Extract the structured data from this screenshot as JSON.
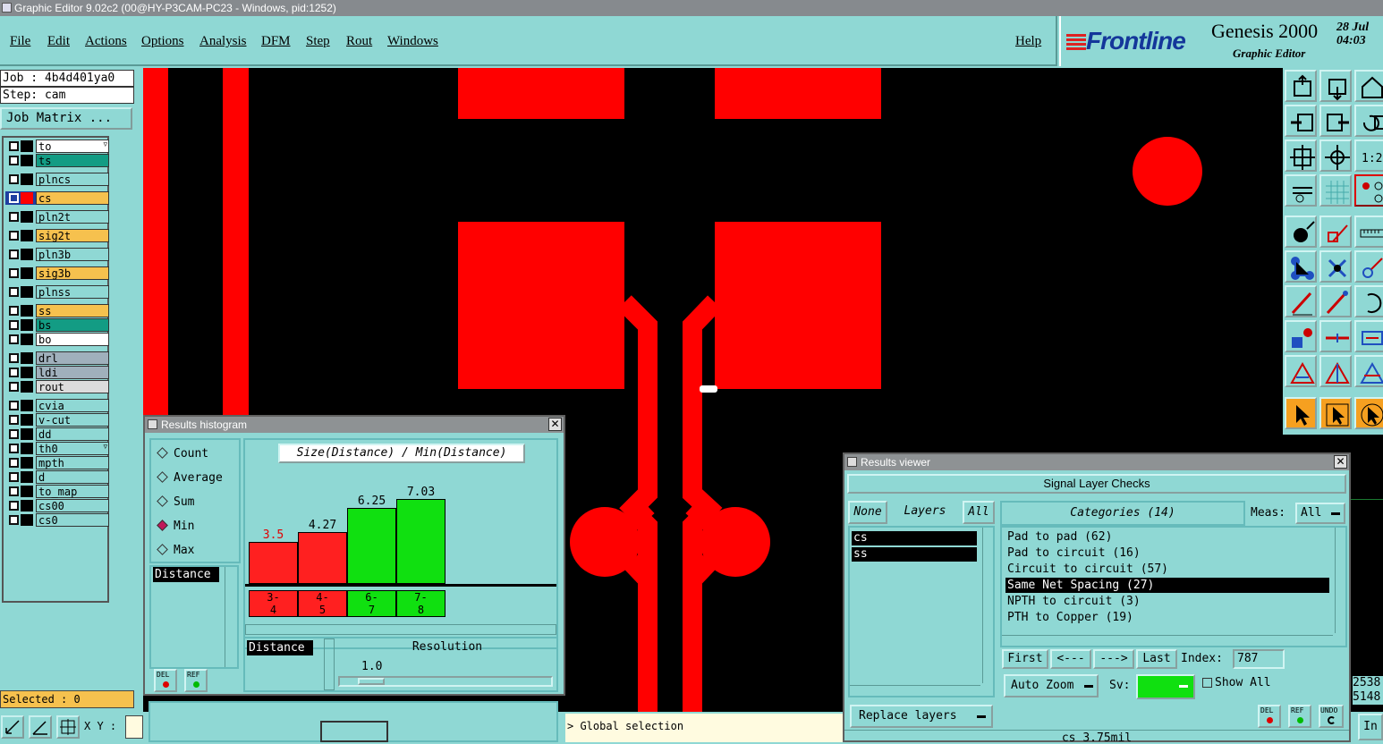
{
  "window": {
    "title": "Graphic Editor 9.02c2 (00@HY-P3CAM-PC23 - Windows, pid:1252)"
  },
  "menu": {
    "file": "File",
    "edit": "Edit",
    "actions": "Actions",
    "options": "Options",
    "analysis": "Analysis",
    "dfm": "DFM",
    "step": "Step",
    "rout": "Rout",
    "windows": "Windows",
    "help": "Help"
  },
  "brand": {
    "logo": "Frontline",
    "product": "Genesis 2000",
    "subtitle": "Graphic Editor",
    "date_line1": "28 Jul",
    "date_line2": "04:03"
  },
  "job": {
    "job": "Job : 4b4d401ya0",
    "step": "Step: cam",
    "matrix_button": "Job Matrix ..."
  },
  "layers": [
    {
      "name": "to",
      "color": "#ffffff",
      "mark": "▿"
    },
    {
      "name": "ts",
      "color": "#139c84"
    },
    {
      "name": "plncs",
      "color": "#8fd8d4"
    },
    {
      "name": "cs",
      "color": "#f6c14e",
      "active": true
    },
    {
      "name": "pln2t",
      "color": "#8fd8d4"
    },
    {
      "name": "sig2t",
      "color": "#f6c14e"
    },
    {
      "name": "pln3b",
      "color": "#8fd8d4"
    },
    {
      "name": "sig3b",
      "color": "#f6c14e"
    },
    {
      "name": "plnss",
      "color": "#8fd8d4"
    },
    {
      "name": "ss",
      "color": "#f6c14e"
    },
    {
      "name": "bs",
      "color": "#139c84"
    },
    {
      "name": "bo",
      "color": "#ffffff"
    },
    {
      "name": "drl",
      "color": "#a0b0bc"
    },
    {
      "name": "ldi",
      "color": "#a0b0bc"
    },
    {
      "name": "rout",
      "color": "#dcdcdc"
    },
    {
      "name": "cvia",
      "color": "#8fd8d4"
    },
    {
      "name": "v-cut",
      "color": "#8fd8d4"
    },
    {
      "name": "dd",
      "color": "#8fd8d4"
    },
    {
      "name": "th0",
      "color": "#8fd8d4",
      "mark": "▿"
    },
    {
      "name": "mpth",
      "color": "#8fd8d4"
    },
    {
      "name": "d",
      "color": "#8fd8d4"
    },
    {
      "name": "to_map",
      "color": "#8fd8d4"
    },
    {
      "name": "cs00",
      "color": "#8fd8d4"
    },
    {
      "name": "cs0",
      "color": "#8fd8d4"
    }
  ],
  "status": {
    "selected": "Selected : 0",
    "xy_label": "X Y :",
    "global_selection": "> Global selection"
  },
  "histogram": {
    "title": "Results histogram",
    "modes": [
      "Count",
      "Average",
      "Sum",
      "Min",
      "Max"
    ],
    "selected_mode": "Min",
    "header": "Size(Distance) / Min(Distance)",
    "list_item": "Distance",
    "bottom_item": "Distance",
    "resolution_label": "Resolution",
    "resolution_value": "1.0",
    "bars": [
      {
        "range": "3-\n4",
        "value": 3.5,
        "label": "3.5",
        "color": "#ff2020"
      },
      {
        "range": "4-\n5",
        "value": 4.27,
        "label": "4.27",
        "color": "#ff2020"
      },
      {
        "range": "6-\n7",
        "value": 6.25,
        "label": "6.25",
        "color": "#10e010"
      },
      {
        "range": "7-\n8",
        "value": 7.03,
        "label": "7.03",
        "color": "#10e010"
      }
    ],
    "del": "DEL",
    "ref": "REF"
  },
  "viewer": {
    "title": "Results viewer",
    "header": "Signal Layer Checks",
    "none": "None",
    "layers_label": "Layers",
    "all": "All",
    "categories_label": "Categories (14)",
    "meas_label": "Meas:",
    "meas_value": "All",
    "layer_items": [
      "cs",
      "ss"
    ],
    "categories": [
      "Pad to pad (62)",
      "Pad to circuit (16)",
      "Circuit to circuit (57)",
      "Same Net Spacing (27)",
      "NPTH to circuit (3)",
      "PTH to Copper (19)"
    ],
    "selected_category": "Same Net Spacing (27)",
    "first": "First",
    "prev": "<---",
    "next": "--->",
    "last": "Last",
    "index_label": "Index:",
    "index_value": "787",
    "auto_zoom": "Auto Zoom",
    "sv_label": "Sv:",
    "show_all": "Show All",
    "replace_layers": "Replace layers",
    "del": "DEL",
    "ref": "REF",
    "undo": "UNDO",
    "status": "cs 3.75mil"
  },
  "right_readout": {
    "line1": "2538",
    "line2": "5148",
    "button": "In"
  },
  "accent": {
    "copper": "#ff0000",
    "panel": "#8fd8d4",
    "titlebar": "#868a8e"
  }
}
